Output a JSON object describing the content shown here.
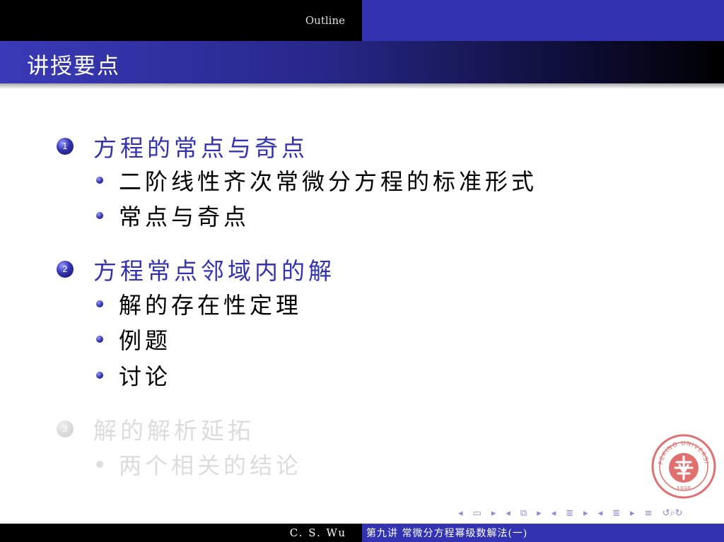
{
  "headline": {
    "section": "Outline"
  },
  "frame": {
    "title": "讲授要点"
  },
  "outline": {
    "sections": [
      {
        "number": "1",
        "title": "方程的常点与奇点",
        "items": [
          "二阶线性齐次常微分方程的标准形式",
          "常点与奇点"
        ]
      },
      {
        "number": "2",
        "title": "方程常点邻域内的解",
        "items": [
          "解的存在性定理",
          "例题",
          "讨论"
        ]
      },
      {
        "number": "3",
        "title": "解的解析延拓",
        "items": [
          "两个相关的结论"
        ]
      }
    ]
  },
  "seal": {
    "text": "PEKING UNIVERSITY",
    "year": "1898"
  },
  "footline": {
    "author": "C. S. Wu",
    "title": "第九讲  常微分方程幂级数解法(一)"
  },
  "colors": {
    "structure": "#3333b2",
    "faded": "#dcdcdc",
    "seal": "#e07070"
  },
  "nav_icons": [
    "frame-prev-icon",
    "frame-next-icon",
    "subsection-prev-icon",
    "subsection-next-icon",
    "section-prev-icon",
    "section-next-icon",
    "doc-prev-icon",
    "doc-next-icon",
    "toc-icon",
    "back-icon",
    "find-icon",
    "forward-icon"
  ]
}
